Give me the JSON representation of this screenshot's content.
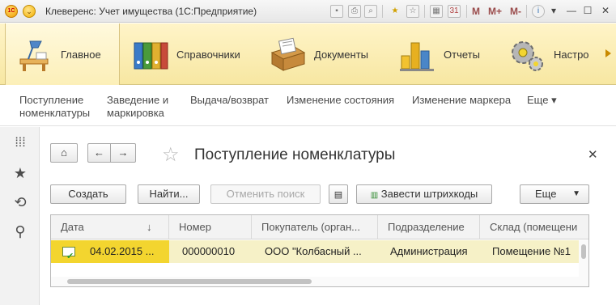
{
  "window": {
    "title": "Клеверенс: Учет имущества  (1С:Предприятие)",
    "toolbar_m": "M",
    "toolbar_mplus": "M+",
    "toolbar_mminus": "M-"
  },
  "sections": [
    {
      "label": "Главное",
      "icon": "home-desk-icon",
      "active": true
    },
    {
      "label": "Справочники",
      "icon": "binders-icon"
    },
    {
      "label": "Документы",
      "icon": "documents-box-icon"
    },
    {
      "label": "Отчеты",
      "icon": "bar-chart-icon"
    },
    {
      "label": "Настро",
      "icon": "gears-icon"
    }
  ],
  "commands": [
    {
      "label": "Поступление\nноменклатуры"
    },
    {
      "label": "Заведение и\nмаркировка"
    },
    {
      "label": "Выдача/возврат"
    },
    {
      "label": "Изменение состояния"
    },
    {
      "label": "Изменение маркера"
    },
    {
      "label": "Еще ▾"
    }
  ],
  "form": {
    "title": "Поступление номенклатуры",
    "buttons": {
      "create": "Создать",
      "find": "Найти...",
      "cancel_search": "Отменить поиск",
      "barcodes": "Завести штрихкоды",
      "more": "Еще"
    }
  },
  "table": {
    "columns": [
      "Дата",
      "Номер",
      "Покупатель (орган...",
      "Подразделение",
      "Склад (помещени"
    ],
    "sort_indicator": "↓",
    "rows": [
      {
        "date": "04.02.2015 ...",
        "number": "000000010",
        "buyer": "ООО \"Колбасный ...",
        "department": "Администрация",
        "warehouse": "Помещение №1"
      }
    ]
  },
  "colors": {
    "accent_yellow": "#f3d52f",
    "sections_bg": "#fff4c8"
  }
}
